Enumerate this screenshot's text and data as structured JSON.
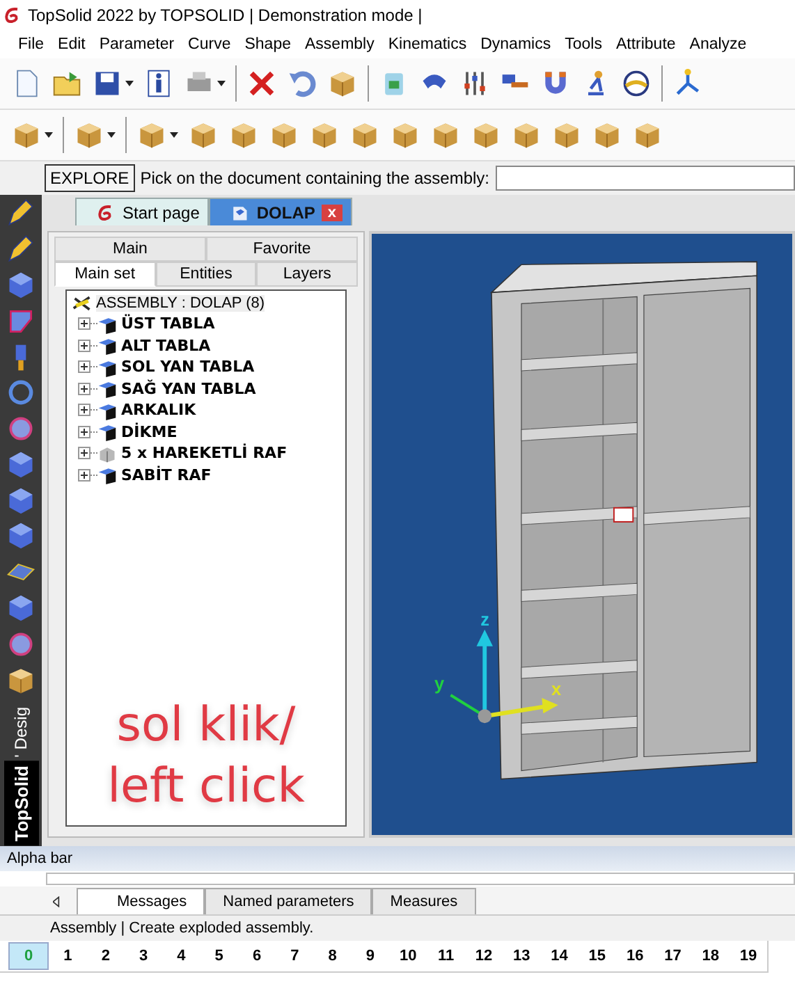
{
  "window": {
    "title": "TopSolid 2022 by TOPSOLID | Demonstration mode |"
  },
  "menu": [
    "File",
    "Edit",
    "Parameter",
    "Curve",
    "Shape",
    "Assembly",
    "Kinematics",
    "Dynamics",
    "Tools",
    "Attribute",
    "Analyze"
  ],
  "command": {
    "button": "EXPLORE",
    "prompt": "Pick on the document containing the assembly:"
  },
  "side_label": {
    "brand": "TopSolid",
    "mode": "' Desig"
  },
  "document_tabs": [
    {
      "label": "Start page",
      "selected": false
    },
    {
      "label": "DOLAP",
      "selected": true,
      "close": "x"
    }
  ],
  "panel_tabs": [
    [
      {
        "label": "Main",
        "selected": false
      },
      {
        "label": "Favorite",
        "selected": false
      }
    ],
    [
      {
        "label": "Main set",
        "selected": true
      },
      {
        "label": "Entities",
        "selected": false
      },
      {
        "label": "Layers",
        "selected": false
      }
    ]
  ],
  "tree": {
    "root": "ASSEMBLY : DOLAP (8)",
    "children": [
      {
        "label": "ÜST TABLA",
        "kind": "part",
        "expanded": false
      },
      {
        "label": "ALT TABLA",
        "kind": "part",
        "expanded": false
      },
      {
        "label": "SOL YAN TABLA",
        "kind": "part",
        "expanded": false
      },
      {
        "label": "SAĞ YAN TABLA",
        "kind": "part",
        "expanded": false
      },
      {
        "label": "ARKALIK",
        "kind": "part",
        "expanded": false
      },
      {
        "label": "DİKME",
        "kind": "part",
        "expanded": false
      },
      {
        "label": "5 x HAREKETLİ RAF",
        "kind": "repetition",
        "expanded": false
      },
      {
        "label": "SABİT RAF",
        "kind": "part",
        "expanded": false
      }
    ]
  },
  "annotation": [
    "sol klik/",
    "left click"
  ],
  "viewport": {
    "axis_labels": [
      "z",
      "y",
      "x"
    ]
  },
  "alpha_bar": {
    "title": "Alpha bar"
  },
  "bottom_tabs": [
    {
      "label": "Messages",
      "selected": true
    },
    {
      "label": "Named parameters",
      "selected": false
    },
    {
      "label": "Measures",
      "selected": false
    }
  ],
  "status_bar": "Assembly | Create exploded assembly.",
  "layers": [
    {
      "label": "0",
      "selected": true
    },
    {
      "label": "1",
      "selected": false
    },
    {
      "label": "2",
      "selected": false
    },
    {
      "label": "3",
      "selected": false
    },
    {
      "label": "4",
      "selected": false
    },
    {
      "label": "5",
      "selected": false
    },
    {
      "label": "6",
      "selected": false
    },
    {
      "label": "7",
      "selected": false
    },
    {
      "label": "8",
      "selected": false
    },
    {
      "label": "9",
      "selected": false
    },
    {
      "label": "10",
      "selected": false
    },
    {
      "label": "11",
      "selected": false
    },
    {
      "label": "12",
      "selected": false
    },
    {
      "label": "13",
      "selected": false
    },
    {
      "label": "14",
      "selected": false
    },
    {
      "label": "15",
      "selected": false
    },
    {
      "label": "16",
      "selected": false
    },
    {
      "label": "17",
      "selected": false
    },
    {
      "label": "18",
      "selected": false
    },
    {
      "label": "19",
      "selected": false
    }
  ]
}
